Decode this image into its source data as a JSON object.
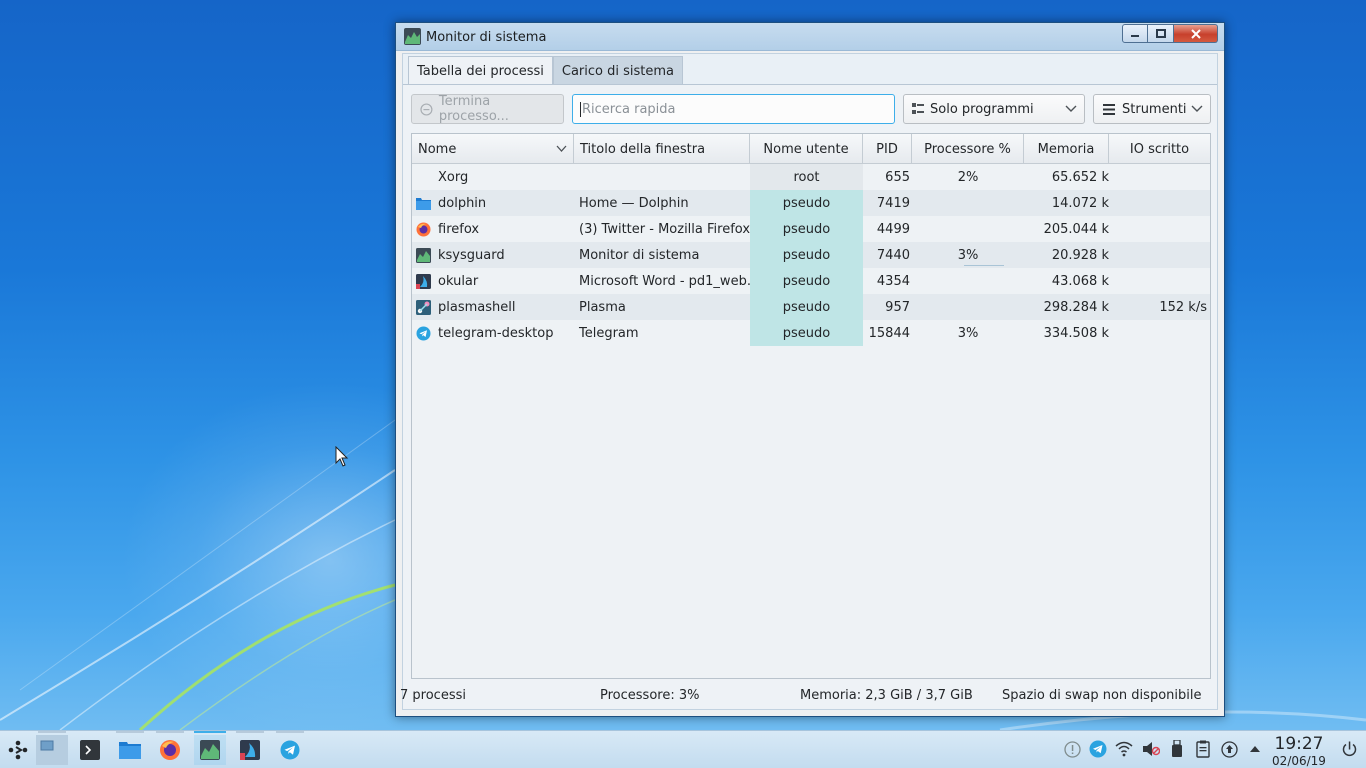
{
  "window": {
    "title": "Monitor di sistema",
    "tabs": [
      {
        "label": "Tabella dei processi",
        "active": true
      },
      {
        "label": "Carico di sistema",
        "active": false
      }
    ]
  },
  "toolbar": {
    "terminate_label": "Termina processo...",
    "search_placeholder": "Ricerca rapida",
    "filter_label": "Solo programmi",
    "tools_label": "Strumenti"
  },
  "table": {
    "columns": [
      "Nome",
      "Titolo della finestra",
      "Nome utente",
      "PID",
      "Processore %",
      "Memoria",
      "IO scritto"
    ],
    "rows": [
      {
        "icon": "none",
        "name": "Xorg",
        "title": "",
        "user": "root",
        "pid": "655",
        "cpu": "2%",
        "mem": "65.652 k",
        "io": ""
      },
      {
        "icon": "folder-icon",
        "name": "dolphin",
        "title": "Home — Dolphin",
        "user": "pseudo",
        "pid": "7419",
        "cpu": "",
        "mem": "14.072 k",
        "io": ""
      },
      {
        "icon": "firefox-icon",
        "name": "firefox",
        "title": "(3) Twitter - Mozilla Firefox",
        "user": "pseudo",
        "pid": "4499",
        "cpu": "",
        "mem": "205.044 k",
        "io": ""
      },
      {
        "icon": "ksysguard-icon",
        "name": "ksysguard",
        "title": "Monitor di sistema",
        "user": "pseudo",
        "pid": "7440",
        "cpu": "3%",
        "mem": "20.928 k",
        "io": ""
      },
      {
        "icon": "okular-icon",
        "name": "okular",
        "title": "Microsoft Word - pd1_web...",
        "user": "pseudo",
        "pid": "4354",
        "cpu": "",
        "mem": "43.068 k",
        "io": ""
      },
      {
        "icon": "plasma-icon",
        "name": "plasmashell",
        "title": "Plasma",
        "user": "pseudo",
        "pid": "957",
        "cpu": "",
        "mem": "298.284 k",
        "io": "152 k/s"
      },
      {
        "icon": "telegram-icon",
        "name": "telegram-desktop",
        "title": "Telegram",
        "user": "pseudo",
        "pid": "15844",
        "cpu": "3%",
        "mem": "334.508 k",
        "io": ""
      }
    ]
  },
  "status": {
    "processes": "7 processi",
    "cpu": "Processore: 3%",
    "memory": "Memoria: 2,3 GiB / 3,7 GiB",
    "swap": "Spazio di swap non disponibile"
  },
  "taskbar": {
    "time": "19:27",
    "date": "02/06/19"
  },
  "colors": {
    "accent": "#3daee9",
    "user_highlight": "#bfe5e6",
    "close_button": "#c7402c"
  }
}
